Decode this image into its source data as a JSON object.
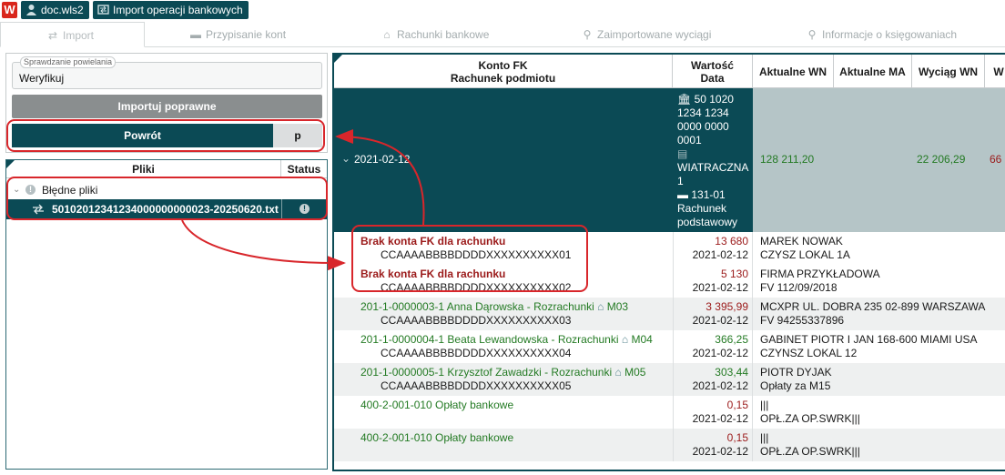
{
  "topbar": {
    "logo": "W",
    "user": "doc.wls2",
    "module": "Import operacji bankowych"
  },
  "tabs": [
    {
      "label": "Import",
      "icon": "import-icon"
    },
    {
      "label": "Przypisanie kont",
      "icon": "folder-icon"
    },
    {
      "label": "Rachunki bankowe",
      "icon": "bank-icon"
    },
    {
      "label": "Zaimportowane wyciągi",
      "icon": "search-icon"
    },
    {
      "label": "Informacje o księgowaniach",
      "icon": "search-icon"
    }
  ],
  "verify": {
    "legend": "Sprawdzanie powielania",
    "value": "Weryfikuj"
  },
  "buttons": {
    "import_correct": "Importuj poprawne",
    "back": "Powrót",
    "p": "p"
  },
  "files": {
    "col_files": "Pliki",
    "col_status": "Status",
    "group": "Błędne pliki",
    "file": "50102012341234000000000023-20250620.txt"
  },
  "table": {
    "headers": {
      "konto_fk": "Konto FK",
      "rachunek": "Rachunek podmiotu",
      "wartosc": "Wartość",
      "data": "Data",
      "akt_wn": "Aktualne WN",
      "akt_ma": "Aktualne MA",
      "wyciag_wn": "Wyciąg WN",
      "w": "W"
    },
    "group": {
      "date": "2021-02-12",
      "account": "50 1020 1234 1234 0000 0000 0001",
      "bank": "WIATRACZNA 1",
      "account_code": "131-01",
      "account_name": "Rachunek podstawowy",
      "akt_wn": "128 211,20",
      "wyciag_wn": "22 206,29",
      "w": "66"
    },
    "rows": [
      {
        "line1": "Brak konta FK dla rachunku",
        "line2": "CCAAAABBBBDDDDXXXXXXXXXX01",
        "value": "13 680",
        "date": "2021-02-12",
        "d1": "MAREK NOWAK",
        "d2": "CZYSZ LOKAL 1A",
        "error": "true"
      },
      {
        "line1": "Brak konta FK dla rachunku",
        "line2": "CCAAAABBBBDDDDXXXXXXXXXX02",
        "value": "5 130",
        "date": "2021-02-12",
        "d1": "FIRMA PRZYKŁADOWA",
        "d2": "FV 112/09/2018",
        "error": "true"
      },
      {
        "line1": "201-1-0000003-1 Anna Dąrowska - Rozrachunki",
        "tag": "M03",
        "line2": "CCAAAABBBBDDDDXXXXXXXXXX03",
        "value": "3 395,99",
        "date": "2021-02-12",
        "d1": "MCXPR UL. DOBRA 235 02-899 WARSZAWA",
        "d2": "FV 94255337896"
      },
      {
        "line1": "201-1-0000004-1 Beata Lewandowska - Rozrachunki",
        "tag": "M04",
        "line2": "CCAAAABBBBDDDDXXXXXXXXXX04",
        "value": "366,25",
        "date": "2021-02-12",
        "d1": "GABINET PIOTR I JAN 168-600 MIAMI USA",
        "d2": "CZYNSZ LOKAL 12"
      },
      {
        "line1": "201-1-0000005-1 Krzysztof Zawadzki - Rozrachunki",
        "tag": "M05",
        "line2": "CCAAAABBBBDDDDXXXXXXXXXX05",
        "value": "303,44",
        "date": "2021-02-12",
        "d1": "PIOTR DYJAK",
        "d2": "Opłaty za M15"
      },
      {
        "line1": "400-2-001-010 Opłaty bankowe",
        "line2": "",
        "value": "0,15",
        "date": "2021-02-12",
        "d1": "|||",
        "d2": "OPŁ.ZA OP.SWRK|||"
      },
      {
        "line1": "400-2-001-010 Opłaty bankowe",
        "line2": "",
        "value": "0,15",
        "date": "2021-02-12",
        "d1": "|||",
        "d2": "OPŁ.ZA OP.SWRK|||"
      }
    ]
  },
  "colors": {
    "dark_teal": "#0b4a55",
    "highlight_red": "#d8262b",
    "error_text": "#9b1a1a",
    "account_green": "#237a23",
    "group_fill": "#b5c5c7"
  }
}
